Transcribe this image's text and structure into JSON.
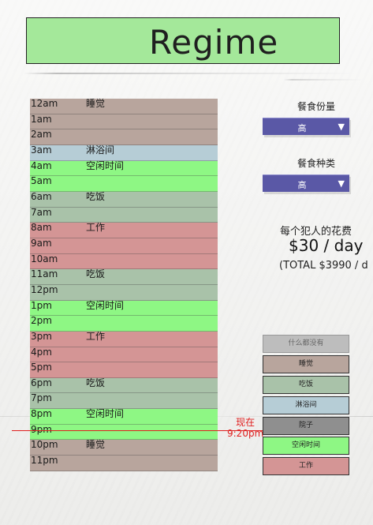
{
  "title": "Regime",
  "schedule": [
    {
      "time": "12am",
      "activity": "睡觉",
      "type": "sleep"
    },
    {
      "time": "1am",
      "activity": "",
      "type": "sleep"
    },
    {
      "time": "2am",
      "activity": "",
      "type": "sleep"
    },
    {
      "time": "3am",
      "activity": "淋浴间",
      "type": "shower"
    },
    {
      "time": "4am",
      "activity": "空闲时间",
      "type": "free"
    },
    {
      "time": "5am",
      "activity": "",
      "type": "free"
    },
    {
      "time": "6am",
      "activity": "吃饭",
      "type": "eat"
    },
    {
      "time": "7am",
      "activity": "",
      "type": "eat"
    },
    {
      "time": "8am",
      "activity": "工作",
      "type": "work"
    },
    {
      "time": "9am",
      "activity": "",
      "type": "work"
    },
    {
      "time": "10am",
      "activity": "",
      "type": "work"
    },
    {
      "time": "11am",
      "activity": "吃饭",
      "type": "eat"
    },
    {
      "time": "12pm",
      "activity": "",
      "type": "eat"
    },
    {
      "time": "1pm",
      "activity": "空闲时间",
      "type": "free"
    },
    {
      "time": "2pm",
      "activity": "",
      "type": "free"
    },
    {
      "time": "3pm",
      "activity": "工作",
      "type": "work"
    },
    {
      "time": "4pm",
      "activity": "",
      "type": "work"
    },
    {
      "time": "5pm",
      "activity": "",
      "type": "work"
    },
    {
      "time": "6pm",
      "activity": "吃饭",
      "type": "eat"
    },
    {
      "time": "7pm",
      "activity": "",
      "type": "eat"
    },
    {
      "time": "8pm",
      "activity": "空闲时间",
      "type": "free"
    },
    {
      "time": "9pm",
      "activity": "",
      "type": "free"
    },
    {
      "time": "10pm",
      "activity": "睡觉",
      "type": "sleep"
    },
    {
      "time": "11pm",
      "activity": "",
      "type": "sleep"
    }
  ],
  "now": {
    "label": "现在",
    "time": "9:20pm"
  },
  "meal_quantity": {
    "label": "餐食份量",
    "value": "高",
    "chevron": "▼"
  },
  "meal_variety": {
    "label": "餐食种类",
    "value": "高",
    "chevron": "▼"
  },
  "cost": {
    "label": "每个犯人的花费",
    "per_day": "$30 / day",
    "total": "(TOTAL $3990 / d"
  },
  "legend": [
    {
      "id": "nothing",
      "label": "什么都没有",
      "color": "#bdbdbd"
    },
    {
      "id": "sleep",
      "label": "睡觉",
      "color": "#b8a59d"
    },
    {
      "id": "eat",
      "label": "吃饭",
      "color": "#a9c2a9"
    },
    {
      "id": "shower",
      "label": "淋浴间",
      "color": "#b6cdd6"
    },
    {
      "id": "yard",
      "label": "院子",
      "color": "#8f8f8f"
    },
    {
      "id": "free",
      "label": "空闲时间",
      "color": "#8ef784"
    },
    {
      "id": "work",
      "label": "工作",
      "color": "#d49595"
    }
  ]
}
